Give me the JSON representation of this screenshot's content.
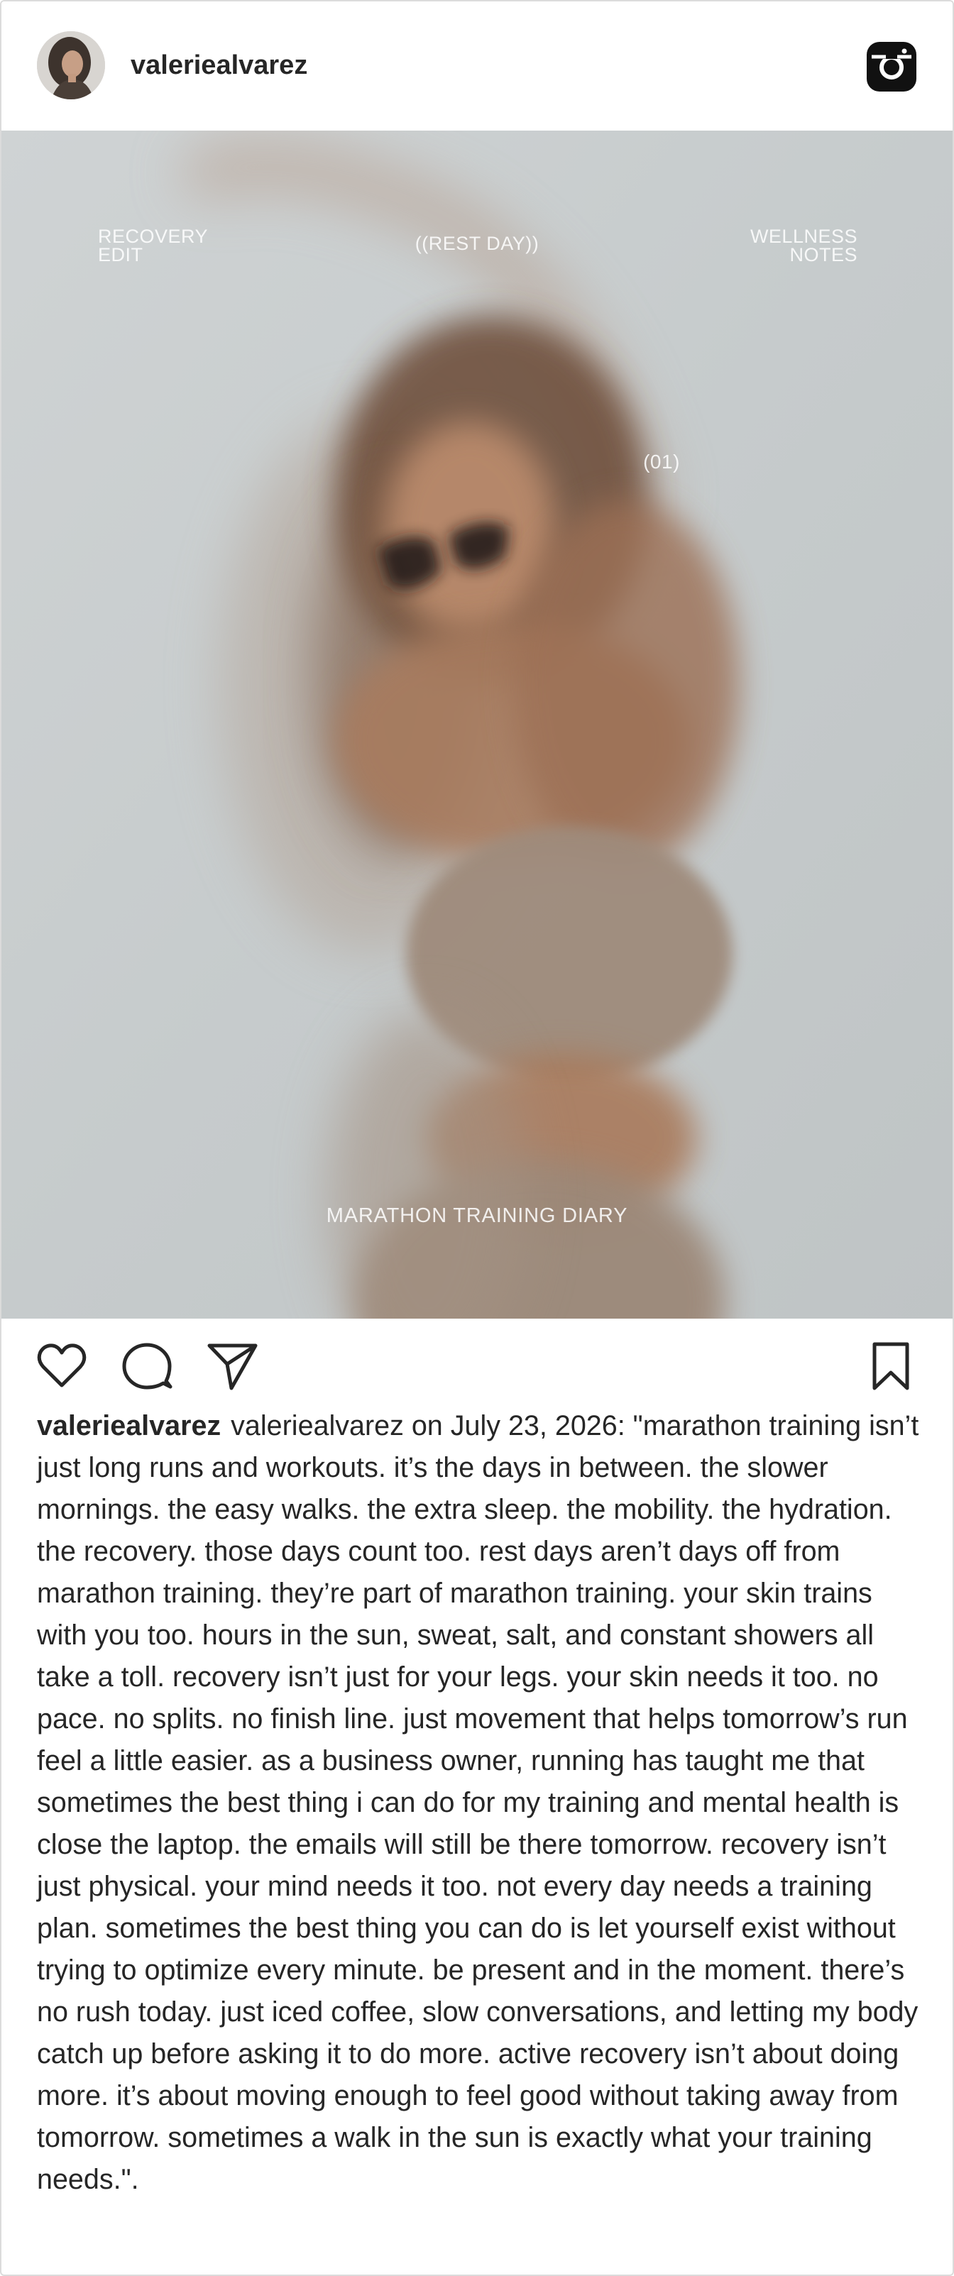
{
  "header": {
    "username": "valeriealvarez",
    "avatar_icon": "profile-photo",
    "logo_icon": "instagram-icon"
  },
  "post": {
    "overlay": {
      "top_left": "RECOVERY\nEDIT",
      "top_center": "((REST DAY))",
      "top_right": "WELLNESS\nNOTES",
      "number": "(01)",
      "bottom": "MARATHON TRAINING DIARY"
    },
    "colors": {
      "background": "#c7ccce",
      "skin": "#a47a5f",
      "outfit": "#9f8b7b",
      "text": "#262626",
      "border": "#dbdbdb"
    }
  },
  "actions": {
    "like_icon": "heart-icon",
    "comment_icon": "comment-icon",
    "share_icon": "paper-plane-icon",
    "save_icon": "bookmark-icon"
  },
  "caption": {
    "username": "valeriealvarez",
    "text": "valeriealvarez on July 23, 2026: \"marathon training isn’t just long runs and workouts. it’s the days in between. the slower mornings. the easy walks. the extra sleep. the mobility. the hydration. the recovery. those days count too. rest days aren’t days off from marathon training. they’re part of marathon training. your skin trains with you too. hours in the sun, sweat, salt, and constant showers all take a toll. recovery isn’t just for your legs. your skin needs it too. no pace. no splits. no finish line. just movement that helps tomorrow’s run feel a little easier. as a business owner, running has taught me that sometimes the best thing i can do for my training and mental health is close the laptop. the emails will still be there tomorrow. recovery isn’t just physical. your mind needs it too. not every day needs a training plan. sometimes the best thing you can do is let yourself exist without trying to optimize every minute. be present and in the moment. there’s no rush today. just iced coffee, slow conversations, and letting my body catch up before asking it to do more. active recovery isn’t about doing more. it’s about moving enough to feel good without taking away from tomorrow. sometimes a walk in the sun is exactly what your training needs.\"."
  }
}
